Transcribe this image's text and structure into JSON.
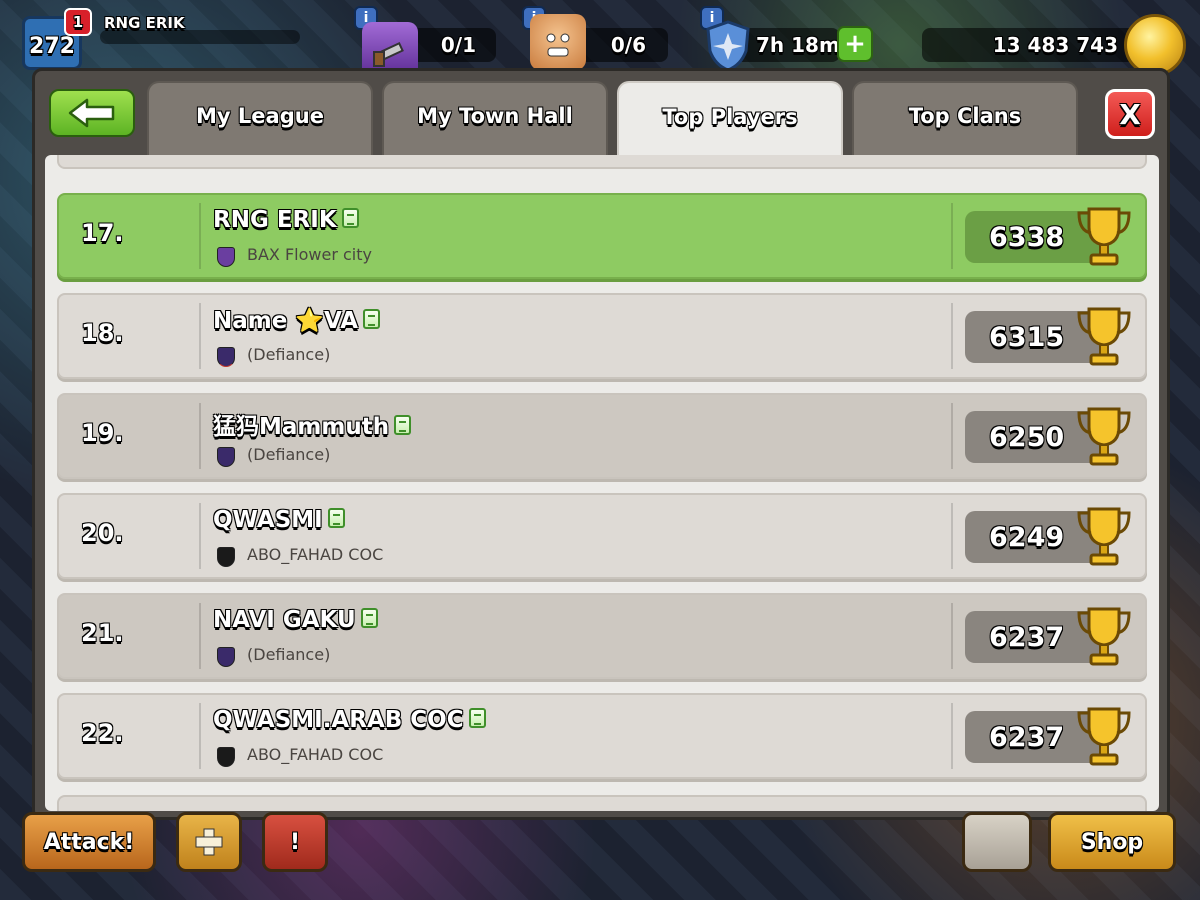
{
  "hud": {
    "level": "272",
    "notification_count": "1",
    "player_name": "RNG ERIK",
    "builder_potion_count": "0/1",
    "builders_count": "0/6",
    "shield_time": "7h 18m",
    "gold_amount": "13 483 743",
    "info_symbol": "i",
    "plus_symbol": "+"
  },
  "nav": {
    "back_icon": "left-arrow-icon",
    "close_label": "X"
  },
  "tabs": [
    {
      "label": "My League",
      "active": false
    },
    {
      "label": "My Town Hall",
      "active": false
    },
    {
      "label": "Top Players",
      "active": true
    },
    {
      "label": "Top Clans",
      "active": false
    }
  ],
  "players": [
    {
      "rank": "17.",
      "name": "RNG ERIK",
      "clan": "BAX Flower city",
      "trophies": "6338",
      "highlight": true,
      "badge_color": "#6a3ea0"
    },
    {
      "rank": "18.",
      "name": "Name ⭐VA",
      "clan": "(Defiance)",
      "trophies": "6315",
      "highlight": false,
      "badge_color": "#3a2a6a"
    },
    {
      "rank": "19.",
      "name": "猛犸Mammuth",
      "clan": "(Defiance)",
      "trophies": "6250",
      "highlight": false,
      "badge_color": "#3a2a6a"
    },
    {
      "rank": "20.",
      "name": "QWASMI",
      "clan": "ABO_FAHAD COC",
      "trophies": "6249",
      "highlight": false,
      "badge_color": "#1a1a1a"
    },
    {
      "rank": "21.",
      "name": "NAVI GAKU",
      "clan": "(Defiance)",
      "trophies": "6237",
      "highlight": false,
      "badge_color": "#3a2a6a"
    },
    {
      "rank": "22.",
      "name": "QWASMI.ARAB COC",
      "clan": "ABO_FAHAD COC",
      "trophies": "6237",
      "highlight": false,
      "badge_color": "#1a1a1a"
    }
  ],
  "bottom": {
    "attack_label": "Attack!",
    "shop_label": "Shop"
  },
  "colors": {
    "highlight_row": "#8ecb62",
    "tab_active": "#ecebe8",
    "close_red": "#e23a36",
    "back_green": "#7ccb38"
  }
}
